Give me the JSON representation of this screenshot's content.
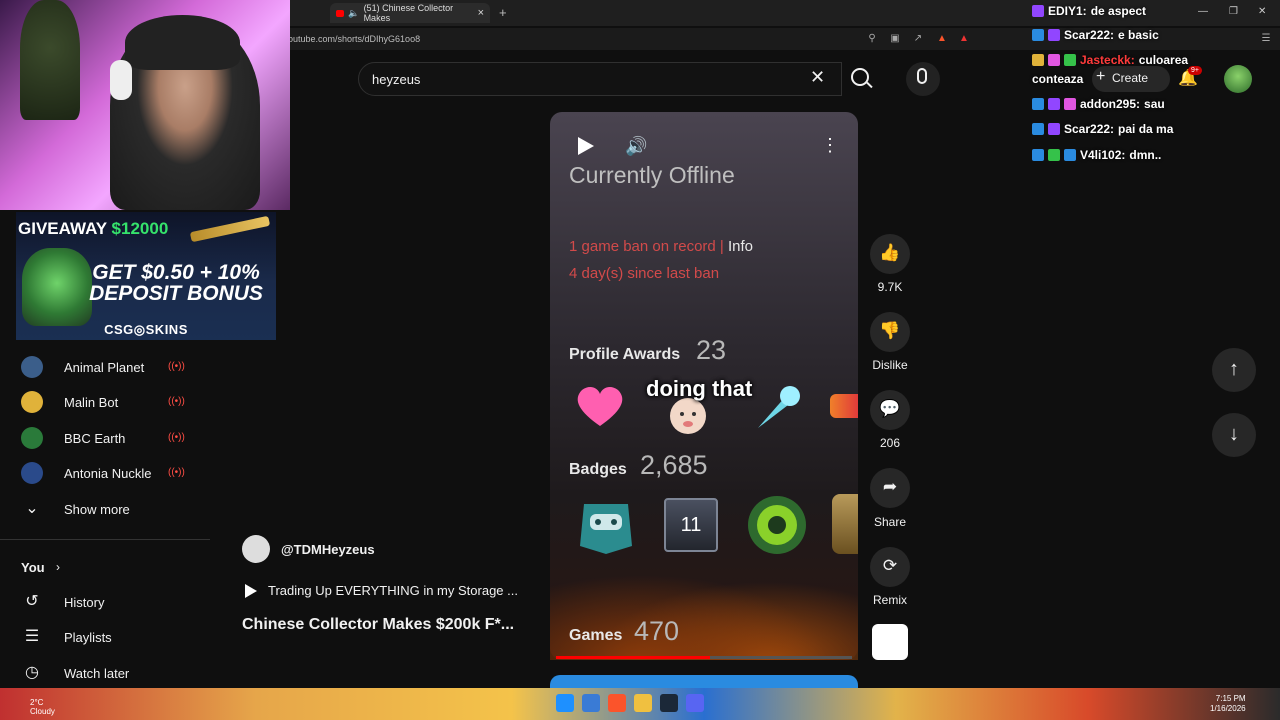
{
  "browser": {
    "tab_title": "(51) Chinese Collector Makes",
    "url": "outube.com/shorts/dDIhyG61oo8"
  },
  "giveaway": {
    "title_prefix": "GIVEAWAY ",
    "amount": "$12000",
    "line1": "GET $0.50 + 10%",
    "line2": "DEPOSIT BONUS",
    "brand": "CSG◎SKINS"
  },
  "sidebar": {
    "channels": [
      {
        "label": "Animal Planet",
        "live": "((•))",
        "color": "#3b5e8a"
      },
      {
        "label": "Malin Bot",
        "live": "((•))",
        "color": "#e0b23a"
      },
      {
        "label": "BBC Earth",
        "live": "((•))",
        "color": "#2a7a3a"
      },
      {
        "label": "Antonia Nuckle",
        "live": "((•))",
        "color": "#2a4a8a"
      }
    ],
    "show_more": "Show more",
    "you": "You",
    "items": [
      {
        "label": "History",
        "icon": "↺"
      },
      {
        "label": "Playlists",
        "icon": "☰"
      },
      {
        "label": "Watch later",
        "icon": "◷"
      }
    ]
  },
  "search": {
    "value": "heyzeus"
  },
  "header": {
    "create": "Create",
    "notif_count": "9+"
  },
  "chat": [
    {
      "user": "EDIY1:",
      "msg": "de aspect",
      "color": "#ffffff"
    },
    {
      "user": "Scar222:",
      "msg": "e basic",
      "color": "#ffffff"
    },
    {
      "user": "Jasteckk:",
      "msg": "culoarea",
      "color": "#ff3b3b"
    },
    {
      "user": "conteaza",
      "msg": "",
      "color": "#ffffff"
    },
    {
      "user": "addon295:",
      "msg": "sau",
      "color": "#ffffff"
    },
    {
      "user": "Scar222:",
      "msg": "pai da ma",
      "color": "#ffffff"
    },
    {
      "user": "V4li102:",
      "msg": "dmn..",
      "color": "#ffffff"
    }
  ],
  "short": {
    "status": "Currently Offline",
    "ban_line": "1 game ban on record | ",
    "ban_info": "Info",
    "ban_days": "4 day(s) since last ban",
    "awards_label": "Profile Awards",
    "awards_count": "23",
    "caption": "doing that",
    "badges_label": "Badges",
    "badges_count": "2,685",
    "badge_level": "11",
    "games_label": "Games",
    "games_count": "470",
    "progress": 0.52
  },
  "actions": {
    "likes": "9.7K",
    "dislike": "Dislike",
    "comments": "206",
    "share": "Share",
    "remix": "Remix"
  },
  "channel": {
    "handle": "@TDMHeyzeus",
    "playlist": "Trading Up EVERYTHING in my Storage ...",
    "title": "Chinese Collector Makes $200k F*..."
  },
  "taskbar": {
    "weather_temp": "2°C",
    "weather_desc": "Cloudy",
    "time": "7:15 PM",
    "date": "1/16/2026"
  }
}
